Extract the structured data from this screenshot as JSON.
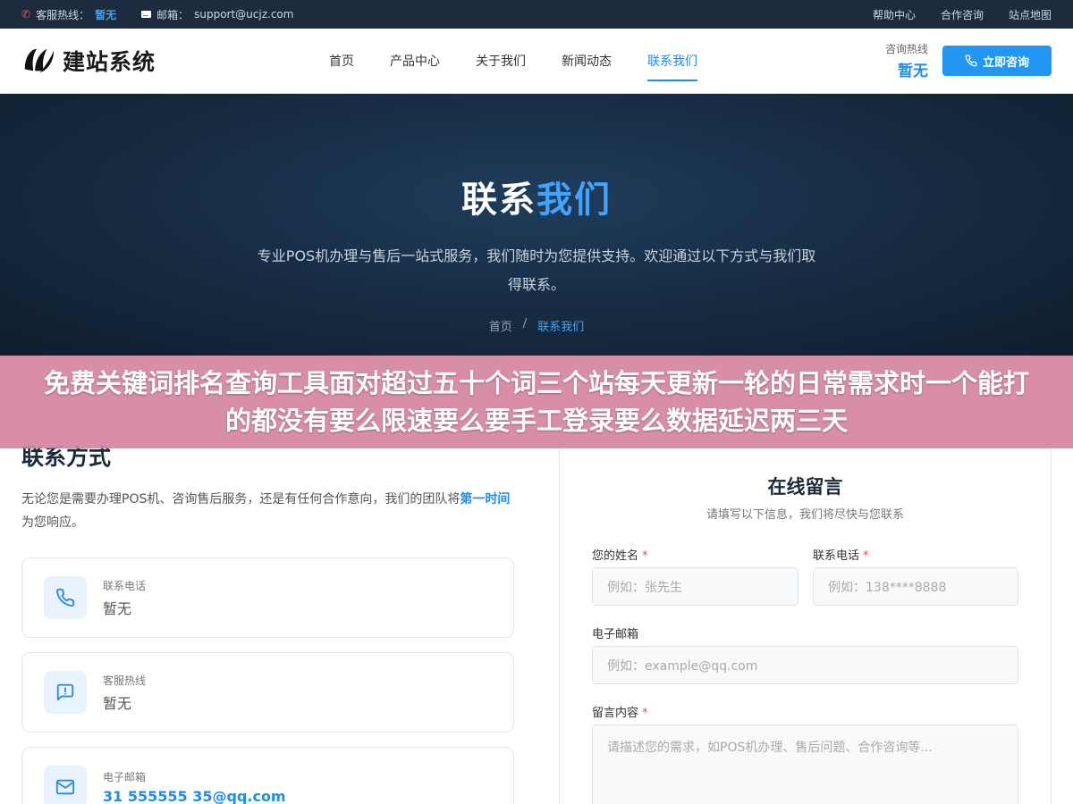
{
  "topbar": {
    "hotline_label": "客服热线：",
    "hotline_value": "暂无",
    "email_label": "邮箱：",
    "email_value": "support@ucjz.com",
    "links": [
      "帮助中心",
      "合作咨询",
      "站点地图"
    ]
  },
  "header": {
    "logo_text": "建站系统",
    "nav": [
      "首页",
      "产品中心",
      "关于我们",
      "新闻动态",
      "联系我们"
    ],
    "active_nav": "联系我们",
    "hotline_label": "咨询热线",
    "hotline_value": "暂无",
    "consult_button": "立即咨询"
  },
  "hero": {
    "title_main": "联系",
    "title_accent": "我们",
    "subtitle": "专业POS机办理与售后一站式服务，我们随时为您提供支持。欢迎通过以下方式与我们取得联系。",
    "breadcrumb_home": "首页",
    "breadcrumb_sep": "/",
    "breadcrumb_current": "联系我们"
  },
  "banner": {
    "text": "免费关键词排名查询工具面对超过五十个词三个站每天更新一轮的日常需求时一个能打的都没有要么限速要么要手工登录要么数据延迟两三天"
  },
  "contact": {
    "title": "联系方式",
    "desc_prefix": "无论您是需要办理POS机、咨询售后服务，还是有任何合作意向，我们的团队将",
    "desc_highlight": "第一时间",
    "desc_suffix": "为您响应。",
    "cards": [
      {
        "label": "联系电话",
        "value": "暂无",
        "icon": "phone-icon"
      },
      {
        "label": "客服热线",
        "value": "暂无",
        "icon": "chat-alert-icon"
      },
      {
        "label": "电子邮箱",
        "value": "31 555555 35@qq.com",
        "icon": "mail-icon"
      }
    ]
  },
  "form": {
    "title": "在线留言",
    "subtitle": "请填写以下信息，我们将尽快与您联系",
    "name_label": "您的姓名",
    "name_placeholder": "例如：张先生",
    "phone_label": "联系电话",
    "phone_placeholder": "例如：138****8888",
    "email_label": "电子邮箱",
    "email_placeholder": "例如：example@qq.com",
    "message_label": "留言内容",
    "message_placeholder": "请描述您的需求，如POS机办理、售后问题、合作咨询等...",
    "required_mark": "*"
  },
  "colors": {
    "accent": "#1e8cf0",
    "topbar_bg": "#1d2b3e",
    "hero_bg": "#162a40",
    "banner_bg": "#d684a0",
    "required": "#e8484b"
  }
}
